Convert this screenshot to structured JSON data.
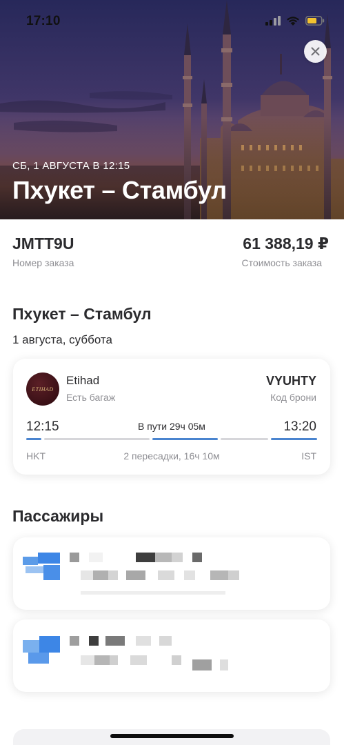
{
  "status_bar": {
    "time": "17:10"
  },
  "hero": {
    "date": "СБ, 1 АВГУСТА В 12:15",
    "title": "Пхукет – Стамбул"
  },
  "order": {
    "id": "JMTT9U",
    "id_label": "Номер заказа",
    "price": "61 388,19 ₽",
    "price_label": "Стоимость заказа"
  },
  "route": {
    "title": "Пхукет – Стамбул",
    "date": "1 августа, суббота"
  },
  "flight": {
    "airline": "Etihad",
    "airline_logo_text": "ETIHAD",
    "baggage": "Есть багаж",
    "booking_code": "VYUHTY",
    "booking_label": "Код брони",
    "departure_time": "12:15",
    "arrival_time": "13:20",
    "duration": "В пути 29ч 05м",
    "departure_code": "HKT",
    "arrival_code": "IST",
    "transfers": "2 пересадки, 16ч 10м"
  },
  "passengers": {
    "title": "Пассажиры"
  },
  "colors": {
    "accent": "#4a84cf",
    "text_primary": "#2b2b2e",
    "text_secondary": "#8e8e93",
    "timeline_inactive": "#d6d6da"
  },
  "icons": [
    "cellular-icon",
    "wifi-icon",
    "battery-icon",
    "close-icon",
    "etihad-logo"
  ]
}
